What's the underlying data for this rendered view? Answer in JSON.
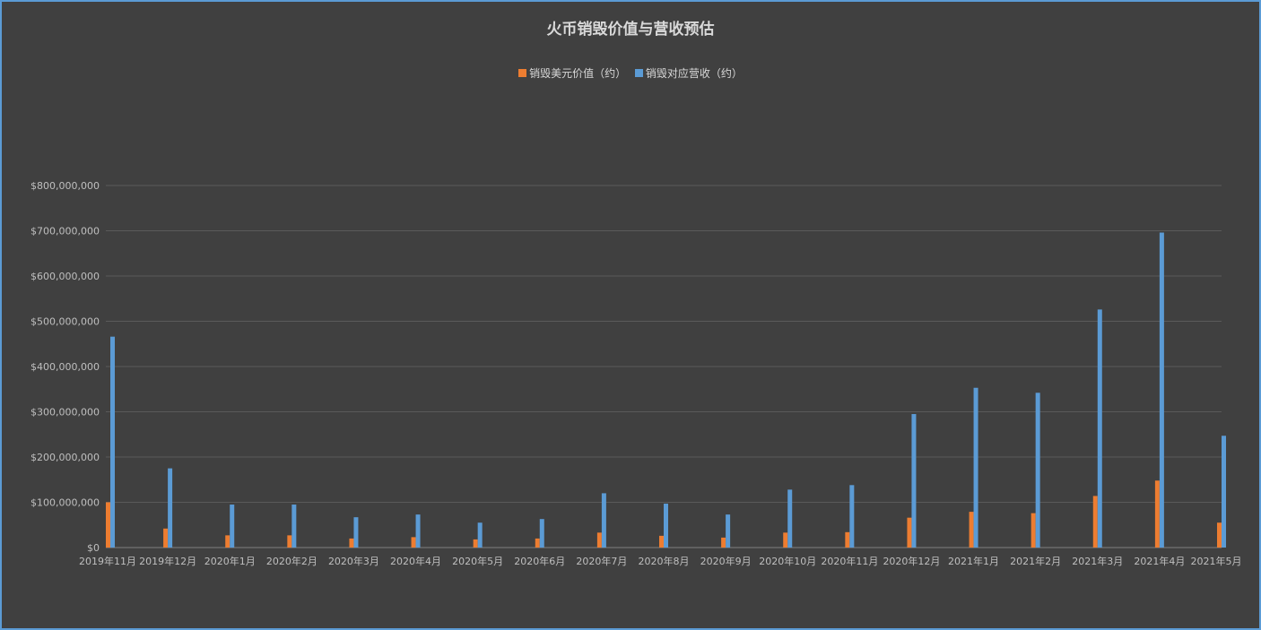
{
  "chart_data": {
    "type": "bar",
    "title": "火币销毁价值与营收预估",
    "categories": [
      "2019年11月",
      "2019年12月",
      "2020年1月",
      "2020年2月",
      "2020年3月",
      "2020年4月",
      "2020年5月",
      "2020年6月",
      "2020年7月",
      "2020年8月",
      "2020年9月",
      "2020年10月",
      "2020年11月",
      "2020年12月",
      "2021年1月",
      "2021年2月",
      "2021年3月",
      "2021年4月",
      "2021年5月"
    ],
    "series": [
      {
        "name": "销毁美元价值（约）",
        "color": "#ed7d31",
        "values": [
          100000000,
          42000000,
          27000000,
          27000000,
          20000000,
          23000000,
          18000000,
          20000000,
          33000000,
          26000000,
          22000000,
          33000000,
          34000000,
          66000000,
          79000000,
          76000000,
          114000000,
          148000000,
          55000000
        ]
      },
      {
        "name": "销毁对应营收（约）",
        "color": "#5b9bd5",
        "values": [
          466000000,
          175000000,
          95000000,
          95000000,
          67000000,
          73000000,
          55000000,
          63000000,
          120000000,
          97000000,
          73000000,
          128000000,
          138000000,
          295000000,
          353000000,
          342000000,
          526000000,
          696000000,
          247000000
        ]
      }
    ],
    "y_ticks": [
      "$0",
      "$100,000,000",
      "$200,000,000",
      "$300,000,000",
      "$400,000,000",
      "$500,000,000",
      "$600,000,000",
      "$700,000,000",
      "$800,000,000"
    ],
    "ylim": [
      0,
      800000000
    ],
    "grid": true,
    "legend": "top-center"
  }
}
